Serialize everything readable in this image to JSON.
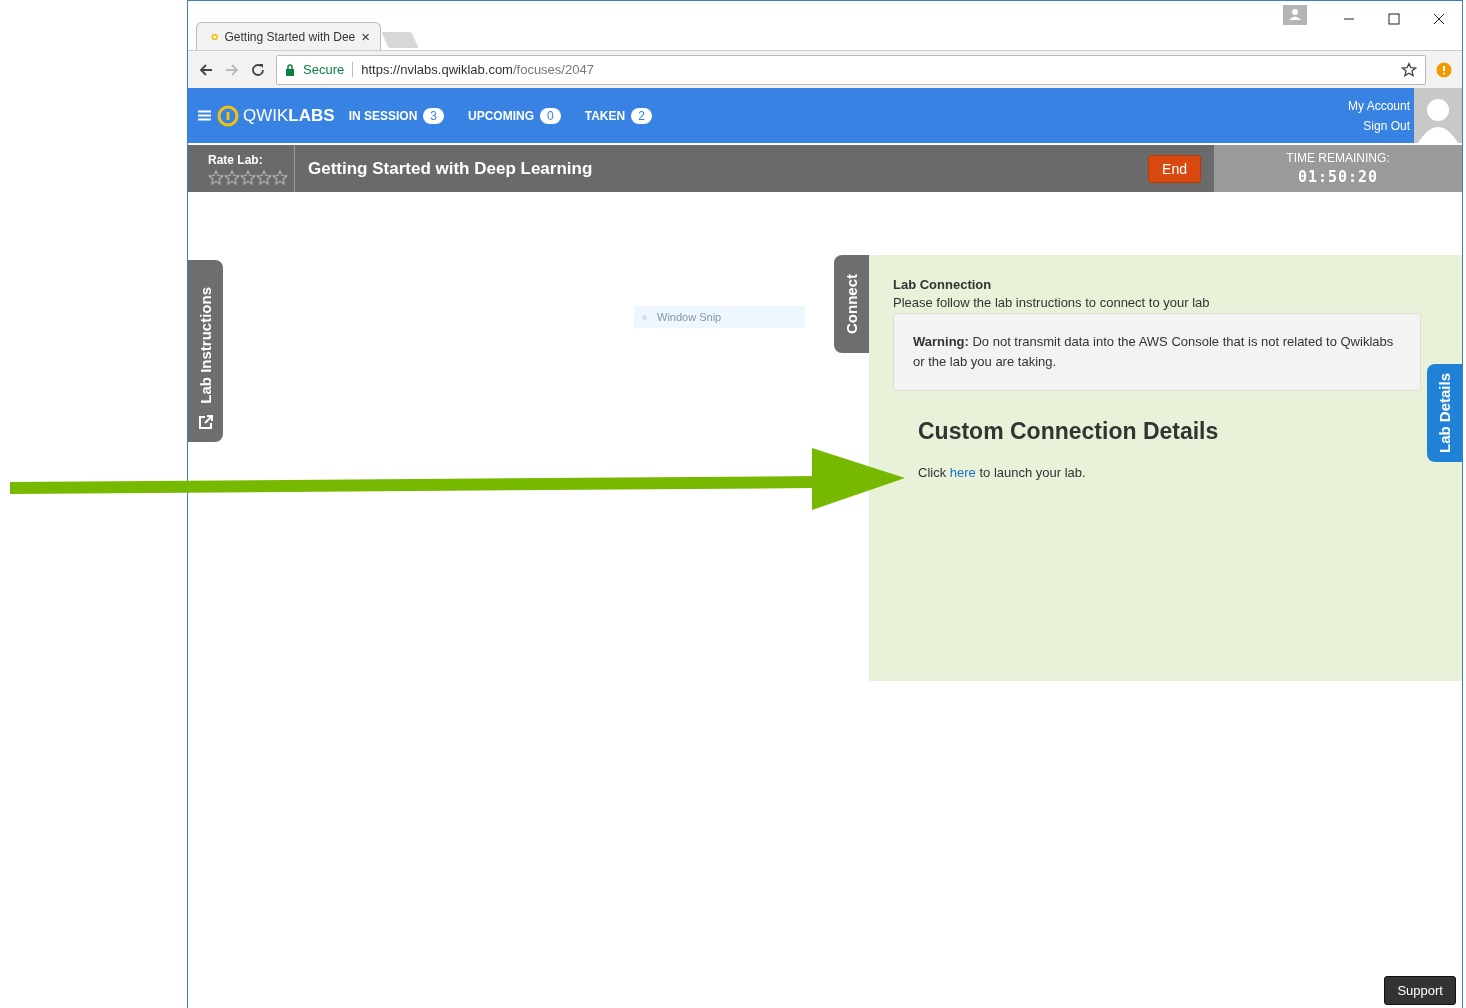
{
  "browser": {
    "tab_title": "Getting Started with Dee",
    "tab_close": "×",
    "security": "Secure",
    "url_host": "https://nvlabs.qwiklab.com",
    "url_path": "/focuses/2047"
  },
  "nav": {
    "logo_light": "QWIK",
    "logo_bold": "LABS",
    "counters": [
      {
        "label": "IN SESSION",
        "count": "3"
      },
      {
        "label": "UPCOMING",
        "count": "0"
      },
      {
        "label": "TAKEN",
        "count": "2"
      }
    ],
    "account_links": [
      "My Account",
      "Sign Out"
    ]
  },
  "lab_bar": {
    "rate_label": "Rate Lab:",
    "stars": 0,
    "title": "Getting Started with Deep Learning",
    "end_button": "End",
    "time_label": "TIME REMAINING:",
    "time_value": "01:50:20"
  },
  "side_tabs": {
    "left": "Lab Instructions",
    "connect": "Connect",
    "right": "Lab Details"
  },
  "overlay_label": "Window Snip",
  "connection": {
    "heading": "Lab Connection",
    "subtitle": "Please follow the lab instructions to connect to your lab",
    "warning": "**Warning:** Do not transmit data into the AWS Console that is not related to Qwiklabs or the lab you are taking.",
    "details_title": "Custom Connection Details",
    "launch_before": "Click",
    "launch_link": "here",
    "launch_after": "to launch your lab."
  },
  "support_button": "Support"
}
